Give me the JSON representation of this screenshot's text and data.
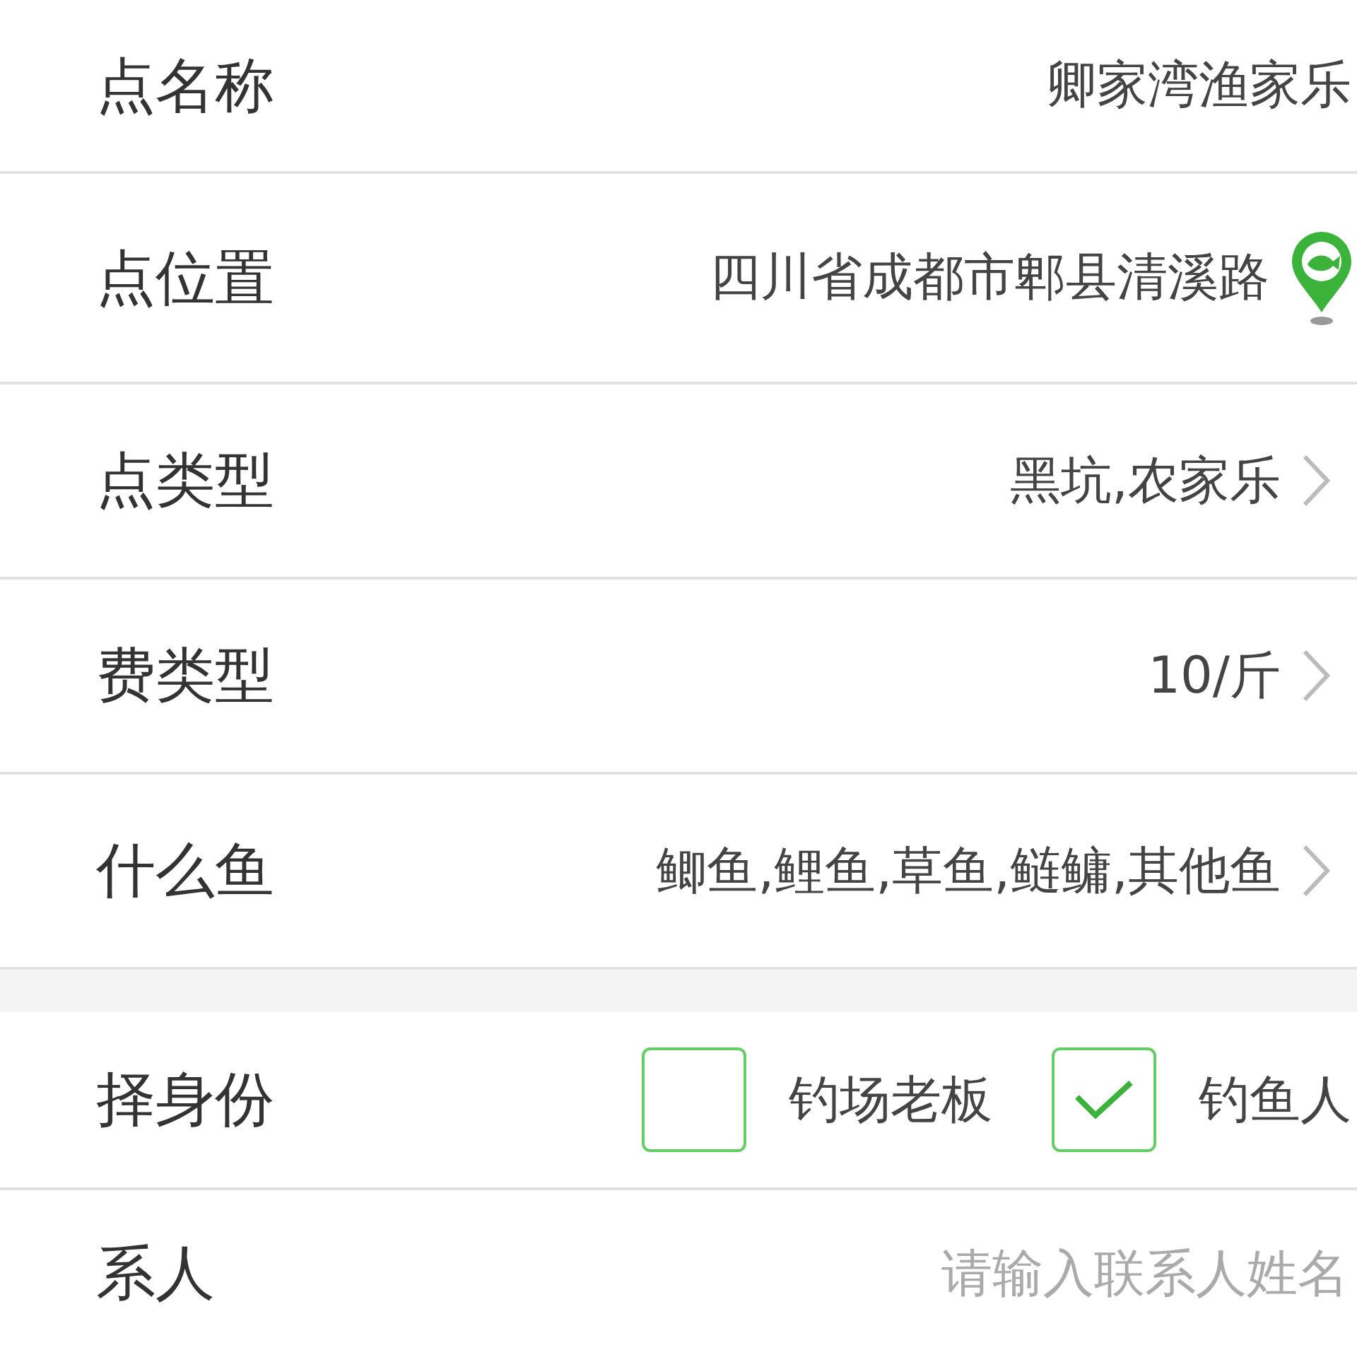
{
  "sections": [
    {
      "rows": [
        {
          "kind": "text",
          "label": "点名称",
          "value": "卿家湾渔家乐"
        },
        {
          "kind": "location",
          "label": "点位置",
          "value": "四川省成都市郫县清溪路"
        },
        {
          "kind": "select",
          "label": "点类型",
          "value": "黑坑,农家乐"
        },
        {
          "kind": "select",
          "label": "费类型",
          "value": "10/斤"
        },
        {
          "kind": "select",
          "label": "什么鱼",
          "value": "鲫鱼,鲤鱼,草鱼,鲢鳙,其他鱼"
        }
      ]
    },
    {
      "rows": [
        {
          "kind": "choice",
          "label": "择身份",
          "options": [
            {
              "label": "钓场老板",
              "checked": false
            },
            {
              "label": "钓鱼人",
              "checked": true
            }
          ]
        },
        {
          "kind": "input",
          "label": "系人",
          "placeholder": "请输入联系人姓名"
        }
      ]
    }
  ]
}
